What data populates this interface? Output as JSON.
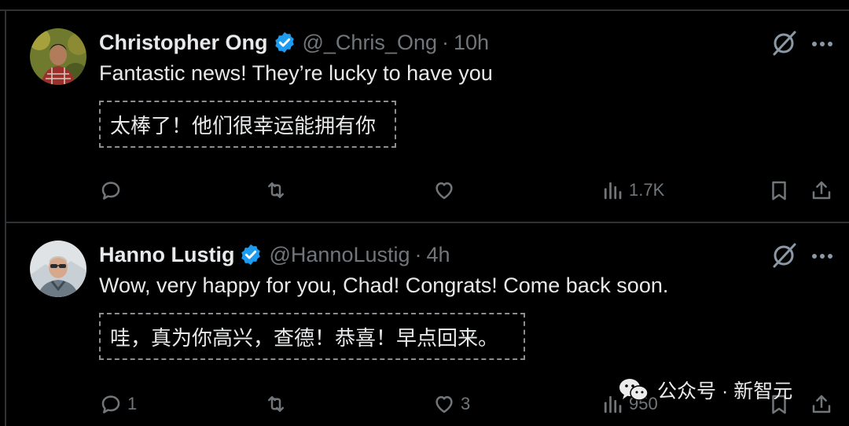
{
  "tweets": [
    {
      "name": "Christopher Ong",
      "handle": "@_Chris_Ong",
      "separator": "·",
      "time": "10h",
      "text": "Fantastic news! They’re lucky to have you",
      "translation": "太棒了！他们很幸运能拥有你",
      "replies": "",
      "retweets": "",
      "likes": "",
      "views": "1.7K"
    },
    {
      "name": "Hanno Lustig",
      "handle": "@HannoLustig",
      "separator": "·",
      "time": "4h",
      "text": "Wow, very happy for you, Chad! Congrats! Come back soon.",
      "translation": "哇，真为你高兴，查德！恭喜！早点回来。",
      "replies": "1",
      "retweets": "",
      "likes": "3",
      "views": "950"
    }
  ],
  "watermark": {
    "text": "公众号 · 新智元",
    "icon": "wechat-icon"
  },
  "colors": {
    "background": "#000000",
    "text": "#e7e9ea",
    "muted": "#71767b",
    "verified": "#1d9bf0",
    "border": "#2f3336"
  }
}
